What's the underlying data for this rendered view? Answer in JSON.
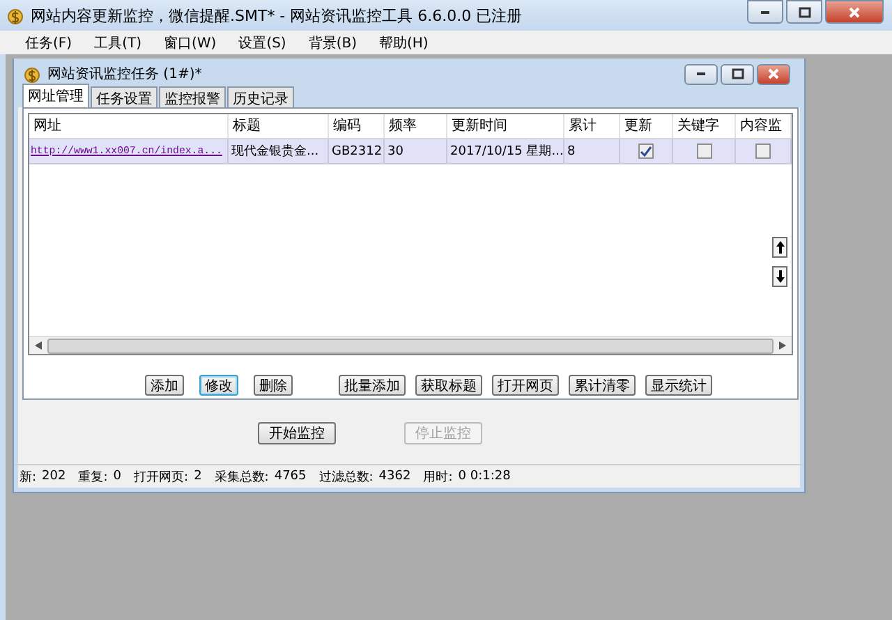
{
  "window": {
    "title": "网站内容更新监控，微信提醒.SMT* - 网站资讯监控工具 6.6.0.0  已注册"
  },
  "menu": [
    {
      "label": "任务(F)"
    },
    {
      "label": "工具(T)"
    },
    {
      "label": "窗口(W)"
    },
    {
      "label": "设置(S)"
    },
    {
      "label": "背景(B)"
    },
    {
      "label": "帮助(H)"
    }
  ],
  "child_window": {
    "title": "网站资讯监控任务  (1#)*"
  },
  "tabs": [
    {
      "label": "网址管理",
      "selected": true
    },
    {
      "label": "任务设置",
      "selected": false
    },
    {
      "label": "监控报警",
      "selected": false
    },
    {
      "label": "历史记录",
      "selected": false
    }
  ],
  "table": {
    "columns": [
      {
        "label": "网址",
        "kind": "link"
      },
      {
        "label": "标题",
        "kind": "text"
      },
      {
        "label": "编码",
        "kind": "text"
      },
      {
        "label": "频率",
        "kind": "text"
      },
      {
        "label": "更新时间",
        "kind": "text"
      },
      {
        "label": "累计",
        "kind": "text"
      },
      {
        "label": "更新",
        "kind": "check"
      },
      {
        "label": "关键字",
        "kind": "check"
      },
      {
        "label": "内容监",
        "kind": "check"
      }
    ],
    "rows": [
      {
        "selected": true,
        "cells": [
          "http://www1.xx007.cn/index.a...",
          "现代金银贵金...",
          "GB2312",
          "30",
          "2017/10/15 星期...",
          "8",
          true,
          false,
          false
        ]
      }
    ]
  },
  "edit_buttons": [
    {
      "label": "添加",
      "focused": false
    },
    {
      "label": "修改",
      "focused": true
    },
    {
      "label": "删除",
      "focused": false
    }
  ],
  "tool_buttons": [
    {
      "label": "批量添加",
      "focused": false
    },
    {
      "label": "获取标题",
      "focused": false
    },
    {
      "label": "打开网页",
      "focused": false
    },
    {
      "label": "累计清零",
      "focused": false
    },
    {
      "label": "显示统计",
      "focused": false
    }
  ],
  "monitor_buttons": [
    {
      "label": "开始监控",
      "disabled": false
    },
    {
      "label": "停止监控",
      "disabled": true
    }
  ],
  "status_bar": [
    {
      "label": "新:",
      "value": "202"
    },
    {
      "label": "重复:",
      "value": "0"
    },
    {
      "label": "打开网页:",
      "value": "2"
    },
    {
      "label": "采集总数:",
      "value": "4765"
    },
    {
      "label": "过滤总数:",
      "value": "4362"
    },
    {
      "label": "用时:",
      "value": "0 0:1:28"
    }
  ]
}
